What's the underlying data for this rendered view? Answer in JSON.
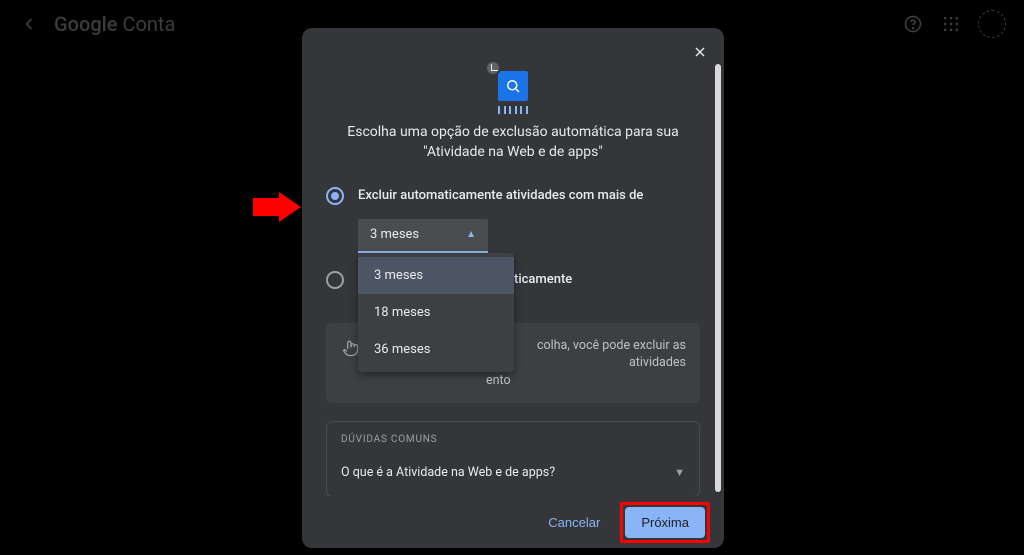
{
  "topbar": {
    "title_brand": "Google",
    "title_product": "Conta"
  },
  "modal": {
    "heading": "Escolha uma opção de exclusão automática para sua \"Atividade na Web e de apps\"",
    "option1_label": "Excluir automaticamente atividades com mais de",
    "select_value": "3 meses",
    "dropdown_options": [
      "3 meses",
      "18 meses",
      "36 meses"
    ],
    "option2_fragment": "ticamente",
    "info_text_fragment1": "colha, você pode excluir as atividades",
    "info_text_fragment2": "ento",
    "faq_heading": "DÚVIDAS COMUNS",
    "faq_q1": "O que é a Atividade na Web e de apps?",
    "cancel": "Cancelar",
    "next": "Próxima"
  }
}
